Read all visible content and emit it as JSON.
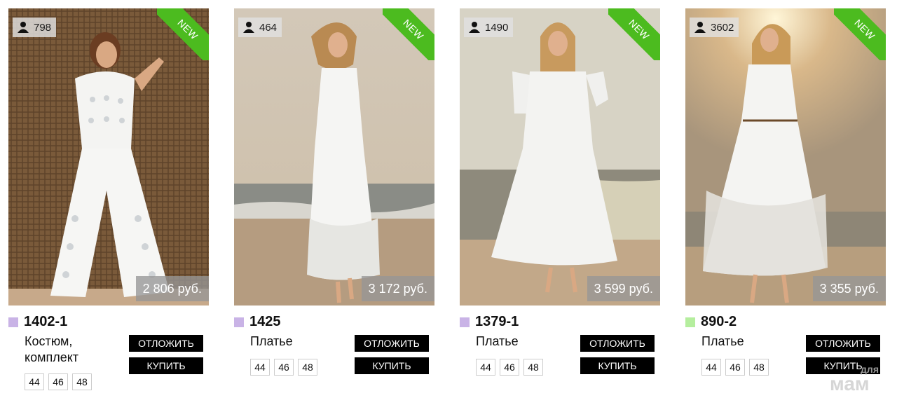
{
  "products": [
    {
      "views": "798",
      "badge": "NEW",
      "price": "2 806 руб.",
      "sku": "1402-1",
      "swatch_color": "#c9b3e6",
      "name": "Костюм, комплект",
      "reserve_label": "ОТЛОЖИТЬ",
      "buy_label": "КУПИТЬ",
      "sizes": [
        "44",
        "46",
        "48"
      ]
    },
    {
      "views": "464",
      "badge": "NEW",
      "price": "3 172 руб.",
      "sku": "1425",
      "swatch_color": "#c9b3e6",
      "name": "Платье",
      "reserve_label": "ОТЛОЖИТЬ",
      "buy_label": "КУПИТЬ",
      "sizes": [
        "44",
        "46",
        "48"
      ]
    },
    {
      "views": "1490",
      "badge": "NEW",
      "price": "3 599 руб.",
      "sku": "1379-1",
      "swatch_color": "#c9b3e6",
      "name": "Платье",
      "reserve_label": "ОТЛОЖИТЬ",
      "buy_label": "КУПИТЬ",
      "sizes": [
        "44",
        "46",
        "48"
      ]
    },
    {
      "views": "3602",
      "badge": "NEW",
      "price": "3 355 руб.",
      "sku": "890-2",
      "swatch_color": "#b5ee9e",
      "name": "Платье",
      "reserve_label": "ОТЛОЖИТЬ",
      "buy_label": "КУПИТЬ",
      "sizes": [
        "44",
        "46",
        "48"
      ]
    }
  ],
  "watermark": {
    "top": "для",
    "main": "мам"
  }
}
